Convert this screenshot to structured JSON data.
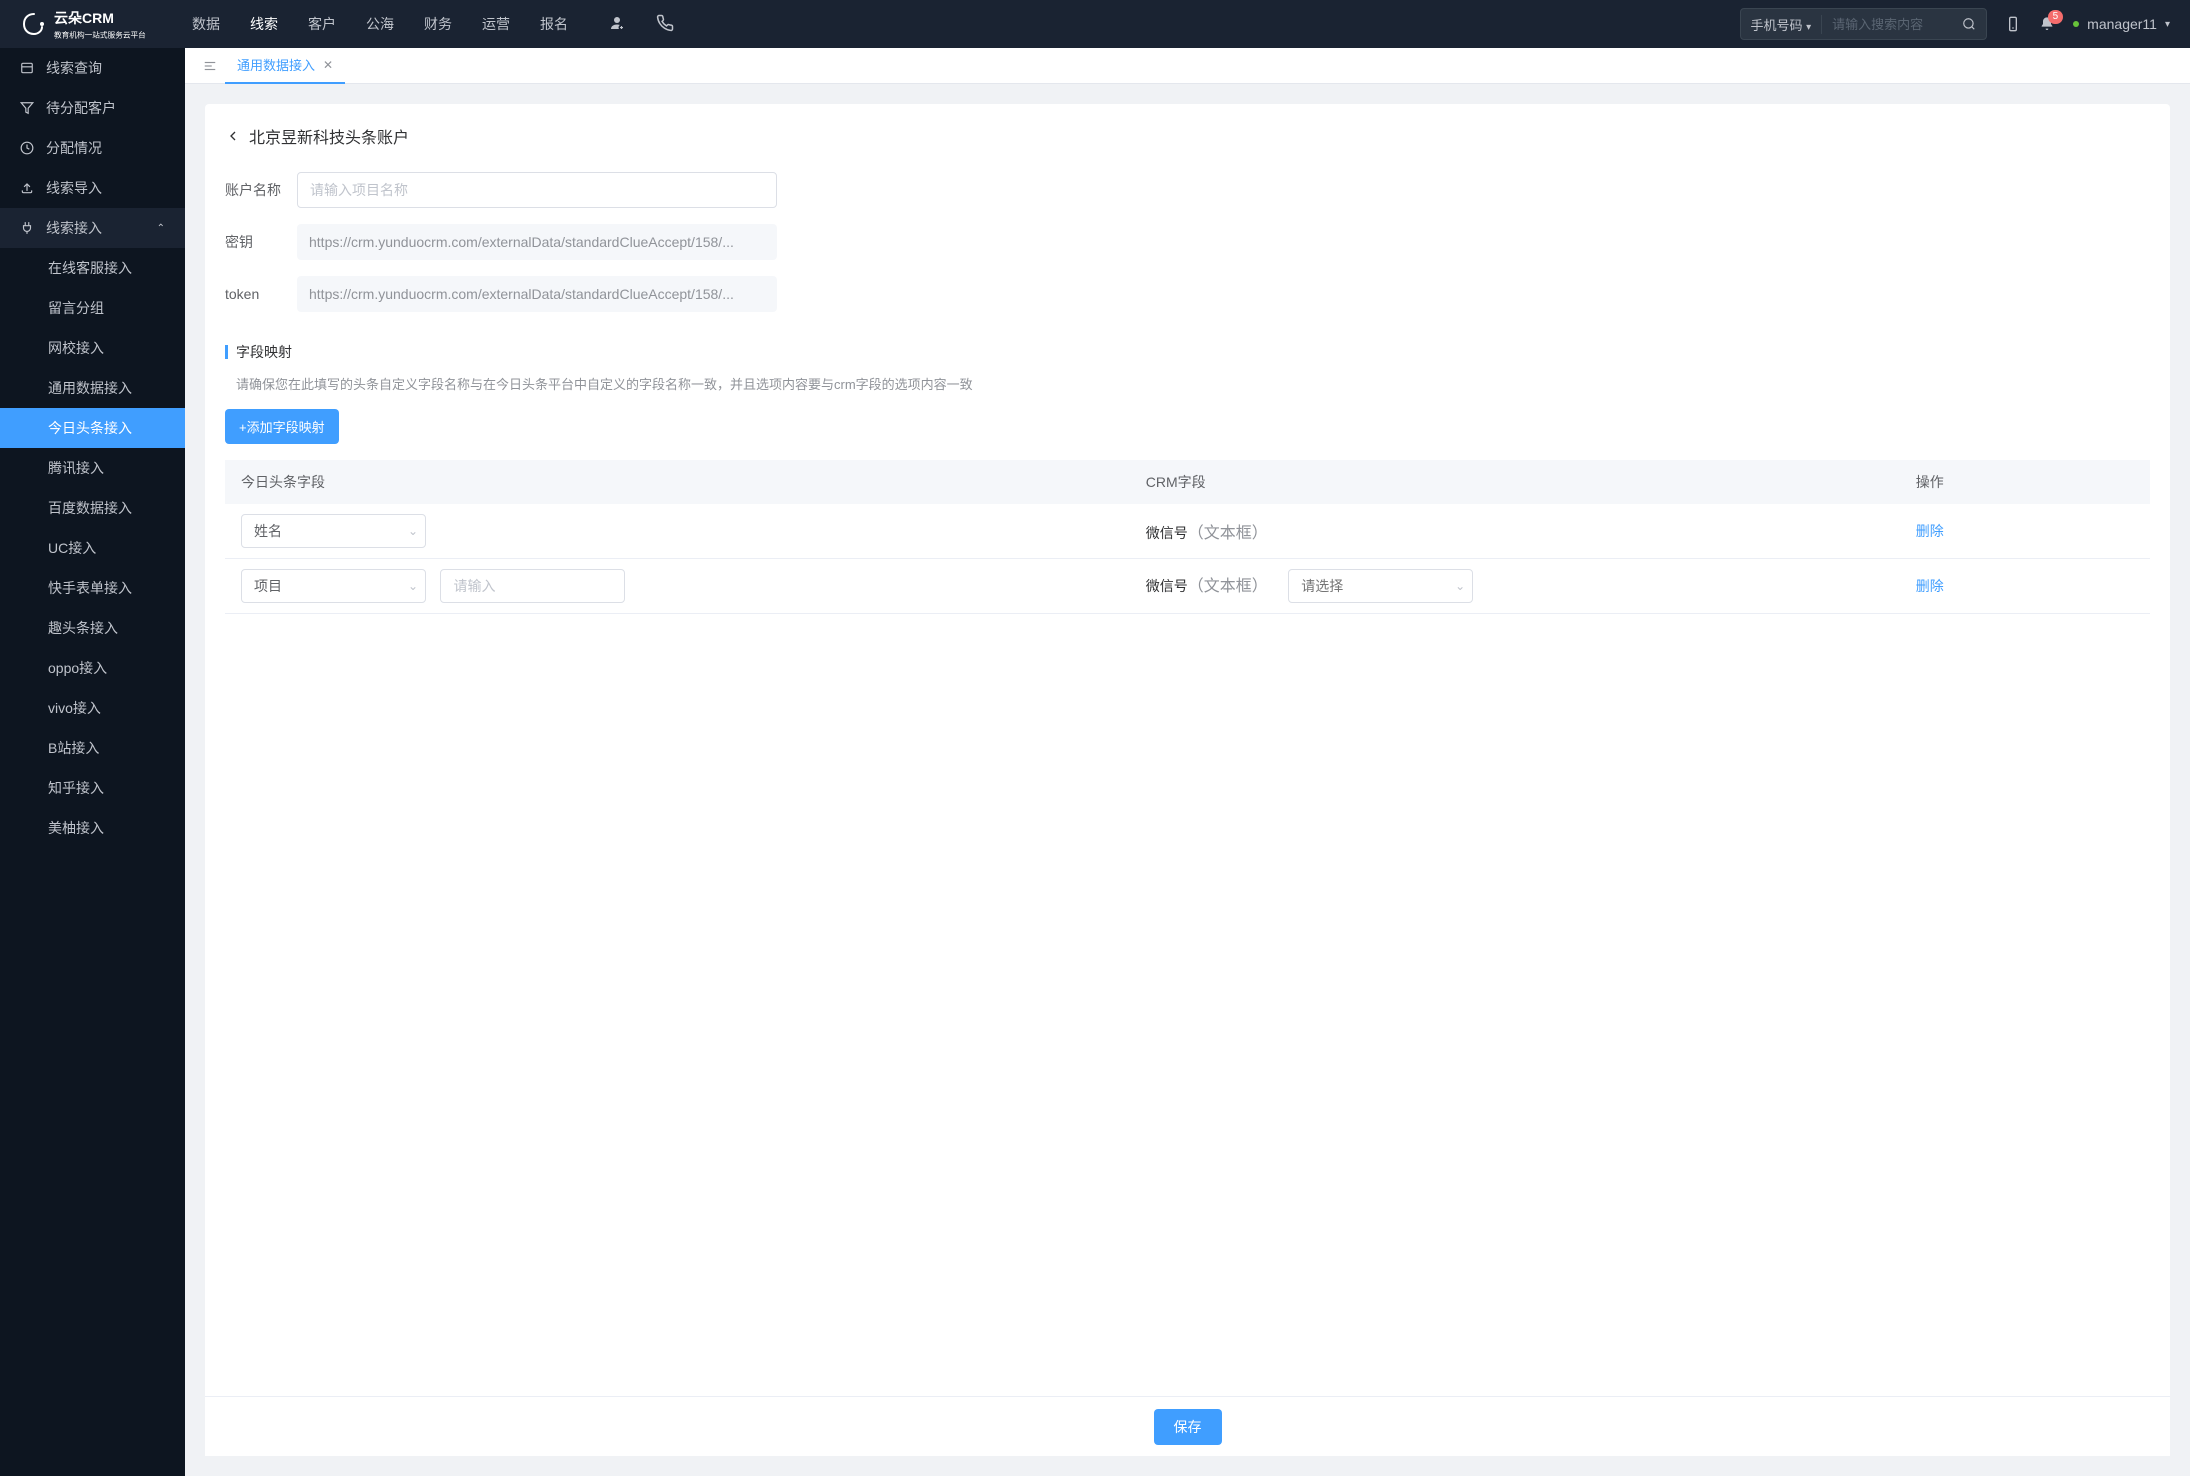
{
  "header": {
    "logo_text": "云朵CRM",
    "logo_sub": "教育机构一站式服务云平台",
    "nav": [
      "数据",
      "线索",
      "客户",
      "公海",
      "财务",
      "运营",
      "报名"
    ],
    "nav_active_index": 1,
    "search_selector": "手机号码",
    "search_placeholder": "请输入搜索内容",
    "notification_badge": "5",
    "username": "manager11"
  },
  "sidebar": {
    "items": [
      {
        "label": "线索查询",
        "icon": "list"
      },
      {
        "label": "待分配客户",
        "icon": "filter"
      },
      {
        "label": "分配情况",
        "icon": "clock"
      },
      {
        "label": "线索导入",
        "icon": "upload"
      },
      {
        "label": "线索接入",
        "icon": "plug",
        "group": true,
        "expanded": true
      }
    ],
    "sub_items": [
      "在线客服接入",
      "留言分组",
      "网校接入",
      "通用数据接入",
      "今日头条接入",
      "腾讯接入",
      "百度数据接入",
      "UC接入",
      "快手表单接入",
      "趣头条接入",
      "oppo接入",
      "vivo接入",
      "B站接入",
      "知乎接入",
      "美柚接入"
    ],
    "sub_active_index": 4
  },
  "tabs": {
    "current": "通用数据接入"
  },
  "page": {
    "breadcrumb_title": "北京昱新科技头条账户",
    "form": {
      "account_label": "账户名称",
      "account_placeholder": "请输入项目名称",
      "secret_label": "密钥",
      "secret_value": "https://crm.yunduocrm.com/externalData/standardClueAccept/158/...",
      "token_label": "token",
      "token_value": "https://crm.yunduocrm.com/externalData/standardClueAccept/158/..."
    },
    "mapping": {
      "section_title": "字段映射",
      "section_desc": "请确保您在此填写的头条自定义字段名称与在今日头条平台中自定义的字段名称一致，并且选项内容要与crm字段的选项内容一致",
      "add_button": "+添加字段映射",
      "columns": {
        "col1": "今日头条字段",
        "col2": "CRM字段",
        "col3": "操作"
      },
      "rows": [
        {
          "toutiao_select": "姓名",
          "crm_name": "微信号",
          "crm_type": "（文本框）",
          "delete": "删除"
        },
        {
          "toutiao_select": "项目",
          "toutiao_input_placeholder": "请输入",
          "crm_name": "微信号",
          "crm_type": "（文本框）",
          "crm_select_placeholder": "请选择",
          "delete": "删除"
        }
      ]
    },
    "save_button": "保存"
  }
}
